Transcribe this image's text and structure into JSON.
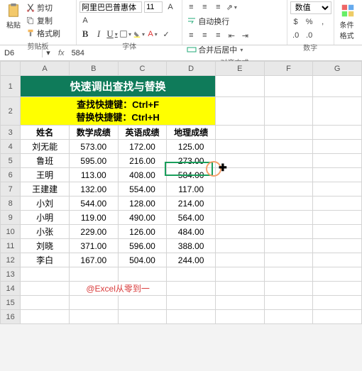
{
  "ribbon": {
    "clipboard": {
      "cut": "剪切",
      "copy": "复制",
      "fmt": "格式刷",
      "paste": "粘贴",
      "label": "剪贴板"
    },
    "font": {
      "name": "阿里巴巴普惠体",
      "size": "11",
      "label": "字体"
    },
    "align": {
      "wrap": "自动换行",
      "merge": "合并后居中",
      "label": "对齐方式"
    },
    "number": {
      "fmt": "数值",
      "label": "数字"
    },
    "styles": {
      "cond": "条件格式"
    }
  },
  "fbar": {
    "name": "D6",
    "fx": "fx",
    "val": "584"
  },
  "cols": [
    "",
    "A",
    "B",
    "C",
    "D",
    "E",
    "F",
    "G"
  ],
  "title": "快速调出查找与替换",
  "shortcuts": "查找快捷键：Ctrl+F\n替换快捷键：Ctrl+H",
  "headers": [
    "姓名",
    "数学成绩",
    "英语成绩",
    "地理成绩"
  ],
  "rows": [
    [
      "刘无能",
      "573.00",
      "172.00",
      "125.00"
    ],
    [
      "鲁班",
      "595.00",
      "216.00",
      "273.00"
    ],
    [
      "王明",
      "113.00",
      "408.00",
      "584.00"
    ],
    [
      "王建建",
      "132.00",
      "554.00",
      "117.00"
    ],
    [
      "小刘",
      "544.00",
      "128.00",
      "214.00"
    ],
    [
      "小明",
      "119.00",
      "490.00",
      "564.00"
    ],
    [
      "小张",
      "229.00",
      "126.00",
      "484.00"
    ],
    [
      "刘晓",
      "371.00",
      "596.00",
      "388.00"
    ],
    [
      "李白",
      "167.00",
      "504.00",
      "244.00"
    ]
  ],
  "watermark": "@Excel从零到一"
}
